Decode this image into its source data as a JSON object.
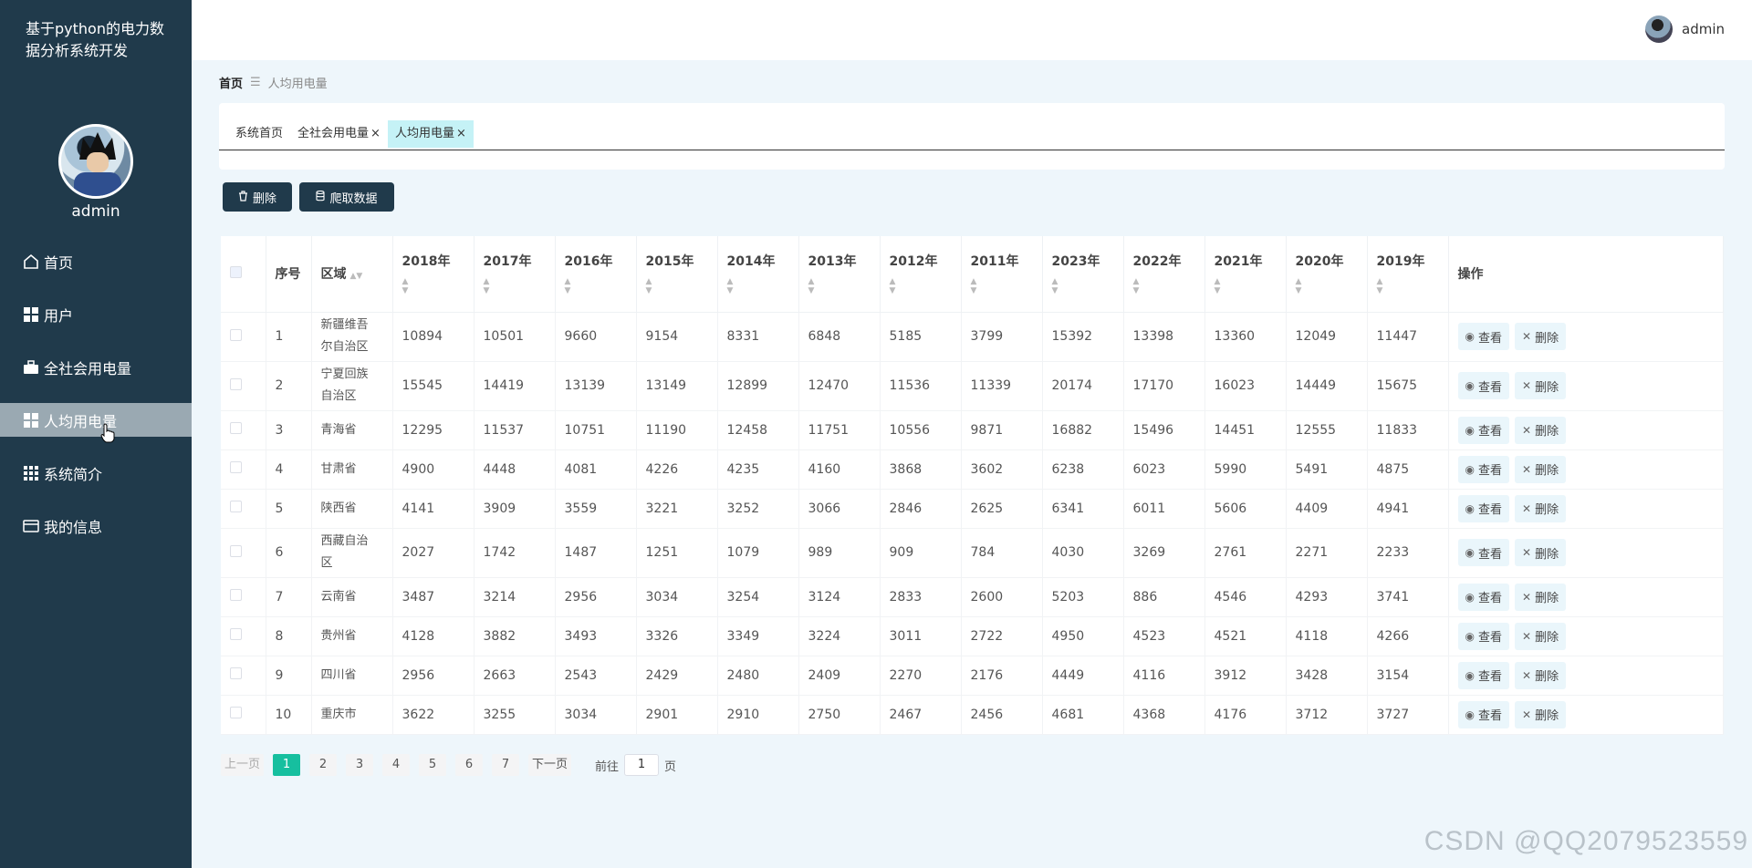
{
  "app_title": "基于python的电力数据分析系统开发",
  "sidebar": {
    "username": "admin",
    "items": [
      {
        "label": "首页",
        "icon": "home-icon"
      },
      {
        "label": "用户",
        "icon": "grid-icon"
      },
      {
        "label": "全社会用电量",
        "icon": "briefcase-icon"
      },
      {
        "label": "人均用电量",
        "icon": "grid-icon"
      },
      {
        "label": "系统简介",
        "icon": "apps-icon"
      },
      {
        "label": "我的信息",
        "icon": "card-icon"
      }
    ]
  },
  "topbar": {
    "username": "admin"
  },
  "breadcrumb": {
    "home": "首页",
    "separator": "☰",
    "current": "人均用电量"
  },
  "tabs": [
    {
      "label": "系统首页"
    },
    {
      "label": "全社会用电量",
      "close": "×"
    },
    {
      "label": "人均用电量",
      "close": "×"
    }
  ],
  "toolbar": {
    "delete_label": "删除",
    "crawl_label": "爬取数据"
  },
  "table": {
    "headers": {
      "index": "序号",
      "region": "区域",
      "actions": "操作"
    },
    "years": [
      "2018年",
      "2017年",
      "2016年",
      "2015年",
      "2014年",
      "2013年",
      "2012年",
      "2011年",
      "2023年",
      "2022年",
      "2021年",
      "2020年",
      "2019年"
    ],
    "view_label": "查看",
    "delete_label": "删除",
    "rows": [
      {
        "idx": "1",
        "region": "新疆维吾尔自治区",
        "values": [
          "10894",
          "10501",
          "9660",
          "9154",
          "8331",
          "6848",
          "5185",
          "3799",
          "15392",
          "13398",
          "13360",
          "12049",
          "11447"
        ]
      },
      {
        "idx": "2",
        "region": "宁夏回族自治区",
        "values": [
          "15545",
          "14419",
          "13139",
          "13149",
          "12899",
          "12470",
          "11536",
          "11339",
          "20174",
          "17170",
          "16023",
          "14449",
          "15675"
        ]
      },
      {
        "idx": "3",
        "region": "青海省",
        "values": [
          "12295",
          "11537",
          "10751",
          "11190",
          "12458",
          "11751",
          "10556",
          "9871",
          "16882",
          "15496",
          "14451",
          "12555",
          "11833"
        ]
      },
      {
        "idx": "4",
        "region": "甘肃省",
        "values": [
          "4900",
          "4448",
          "4081",
          "4226",
          "4235",
          "4160",
          "3868",
          "3602",
          "6238",
          "6023",
          "5990",
          "5491",
          "4875"
        ]
      },
      {
        "idx": "5",
        "region": "陕西省",
        "values": [
          "4141",
          "3909",
          "3559",
          "3221",
          "3252",
          "3066",
          "2846",
          "2625",
          "6341",
          "6011",
          "5606",
          "4409",
          "4941"
        ]
      },
      {
        "idx": "6",
        "region": "西藏自治区",
        "values": [
          "2027",
          "1742",
          "1487",
          "1251",
          "1079",
          "989",
          "909",
          "784",
          "4030",
          "3269",
          "2761",
          "2271",
          "2233"
        ]
      },
      {
        "idx": "7",
        "region": "云南省",
        "values": [
          "3487",
          "3214",
          "2956",
          "3034",
          "3254",
          "3124",
          "2833",
          "2600",
          "5203",
          "886",
          "4546",
          "4293",
          "3741"
        ]
      },
      {
        "idx": "8",
        "region": "贵州省",
        "values": [
          "4128",
          "3882",
          "3493",
          "3326",
          "3349",
          "3224",
          "3011",
          "2722",
          "4950",
          "4523",
          "4521",
          "4118",
          "4266"
        ]
      },
      {
        "idx": "9",
        "region": "四川省",
        "values": [
          "2956",
          "2663",
          "2543",
          "2429",
          "2480",
          "2409",
          "2270",
          "2176",
          "4449",
          "4116",
          "3912",
          "3428",
          "3154"
        ]
      },
      {
        "idx": "10",
        "region": "重庆市",
        "values": [
          "3622",
          "3255",
          "3034",
          "2901",
          "2910",
          "2750",
          "2467",
          "2456",
          "4681",
          "4368",
          "4176",
          "3712",
          "3727"
        ]
      }
    ]
  },
  "pagination": {
    "prev": "上一页",
    "pages": [
      "1",
      "2",
      "3",
      "4",
      "5",
      "6",
      "7"
    ],
    "current": "1",
    "next": "下一页",
    "goto_prefix": "前往",
    "goto_value": "1",
    "goto_suffix": "页"
  },
  "watermark": "CSDN @QQ2079523559",
  "colors": {
    "sidebar_bg": "#203a4b",
    "active_menu_bg": "#9aa9b2",
    "active_page": "#16bf9f",
    "active_tab_bg": "#c5f2f6"
  }
}
